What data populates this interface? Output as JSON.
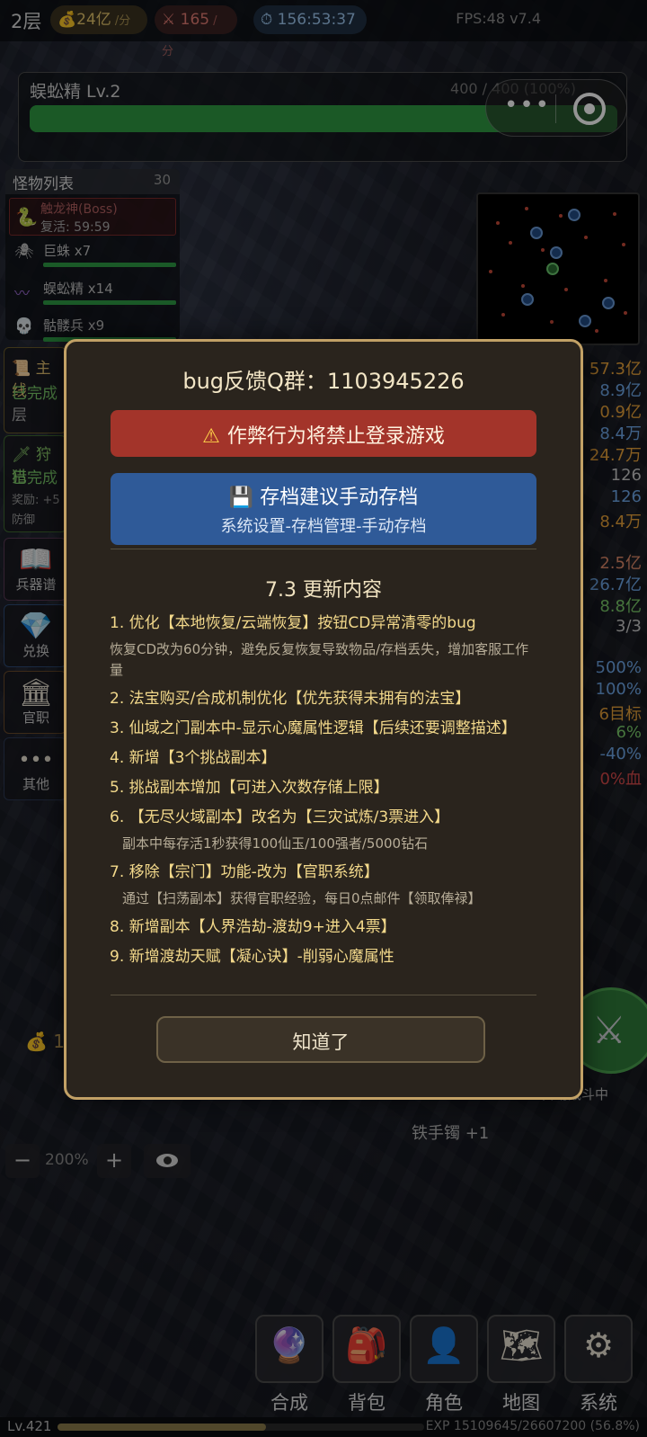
{
  "topbar": {
    "floor": "2层",
    "gold_rate": "24亿",
    "gold_unit": "/分",
    "kill_rate": "165",
    "kill_unit": "/分",
    "timer": "156:53:37",
    "fps": "FPS:48 v7.4"
  },
  "enemy": {
    "name": "蜈蚣精 Lv.2",
    "hp_text": "400 / 400 (100%)",
    "hp_fraction": 1.0
  },
  "monster_list": {
    "title": "怪物列表",
    "count": "30",
    "boss": {
      "name": "触龙神(Boss)",
      "respawn": "复活: 59:59"
    },
    "rows": [
      {
        "label": "巨蛛 x7",
        "icon": "spider-icon"
      },
      {
        "label": "蜈蚣精 x14",
        "icon": "centipede-icon"
      },
      {
        "label": "骷髅兵 x9",
        "icon": "skull-icon"
      }
    ]
  },
  "left_panels": {
    "quest": {
      "title": "主线",
      "status": "已完成",
      "extra": "层"
    },
    "hunt": {
      "title": "狩猎",
      "status": "已完成",
      "reward": "奖励: +5",
      "extra": "防御"
    },
    "tiles": [
      {
        "label": "兵器谱",
        "icon": "book-icon"
      },
      {
        "label": "兑换",
        "icon": "diamond-icon"
      },
      {
        "label": "官职",
        "icon": "bank-icon"
      },
      {
        "label": "其他",
        "icon": "more-icon"
      }
    ]
  },
  "right_stats": [
    {
      "text": "57.3亿",
      "color": "#e8a23a"
    },
    {
      "text": "8.9亿",
      "color": "#6fa8e8"
    },
    {
      "text": "0.9亿",
      "color": "#e8a23a"
    },
    {
      "text": "8.4万",
      "color": "#6fa8e8"
    },
    {
      "text": "24.7万",
      "color": "#e8a23a"
    },
    {
      "text": "126",
      "color": "#c8c8c8"
    },
    {
      "text": "126",
      "color": "#6fa8e8"
    },
    {
      "text": "8.4万",
      "color": "#e8a23a"
    },
    {
      "text": "2.5亿",
      "color": "#e08a6a"
    },
    {
      "text": "26.7亿",
      "color": "#6fa8e8"
    },
    {
      "text": "8.8亿",
      "color": "#7acb6a"
    },
    {
      "text": "3/3",
      "color": "#c8c8c8"
    },
    {
      "text": "500%",
      "color": "#6fa8e8"
    },
    {
      "text": "100%",
      "color": "#6fa8e8"
    },
    {
      "text": "6目标",
      "color": "#e8a23a"
    },
    {
      "text": "6%",
      "color": "#7acb6a"
    },
    {
      "text": "-40%",
      "color": "#6fa8e8"
    },
    {
      "text": "0%血",
      "color": "#d84a4a"
    }
  ],
  "bottom": {
    "money": "12",
    "auto_text": "自动战斗中",
    "loot_text": "铁手镯 +1",
    "zoom_minus": "−",
    "zoom_level": "200%",
    "zoom_plus": "+",
    "nav": [
      {
        "label": "合成",
        "icon": "crystal-ball-icon"
      },
      {
        "label": "背包",
        "icon": "backpack-icon"
      },
      {
        "label": "角色",
        "icon": "person-icon"
      },
      {
        "label": "地图",
        "icon": "map-icon"
      },
      {
        "label": "系统",
        "icon": "gear-icon"
      }
    ],
    "level": "Lv.421",
    "exp_text": "EXP 15109645/26607200 (56.8%)",
    "exp_fraction": 0.568
  },
  "modal": {
    "title": "bug反馈Q群：1103945226",
    "warning": "作弊行为将禁止登录游戏",
    "save_line1": "存档建议手动存档",
    "save_line2": "系统设置-存档管理-手动存档",
    "update_title": "7.3 更新内容",
    "items": [
      {
        "text": "1. 优化【本地恢复/云端恢复】按钮CD异常清零的bug",
        "detail": "恢复CD改为60分钟，避免反复恢复导致物品/存档丢失，增加客服工作量"
      },
      {
        "text": "2. 法宝购买/合成机制优化【优先获得未拥有的法宝】"
      },
      {
        "text": "3. 仙域之门副本中-显示心魔属性逻辑【后续还要调整描述】"
      },
      {
        "text": "4. 新增【3个挑战副本】"
      },
      {
        "text": "5. 挑战副本增加【可进入次数存储上限】"
      },
      {
        "text": "6. 【无尽火域副本】改名为【三灾试炼/3票进入】",
        "detail": "副本中每存活1秒获得100仙玉/100强者/5000钻石"
      },
      {
        "text": "7. 移除【宗门】功能-改为【官职系统】",
        "detail": "通过【扫荡副本】获得官职经验，每日0点邮件【领取俸禄】"
      },
      {
        "text": "8. 新增副本【人界浩劫-渡劫9+进入4票】"
      },
      {
        "text": "9. 新增渡劫天赋【凝心诀】-削弱心魔属性"
      }
    ],
    "ok_label": "知道了"
  }
}
